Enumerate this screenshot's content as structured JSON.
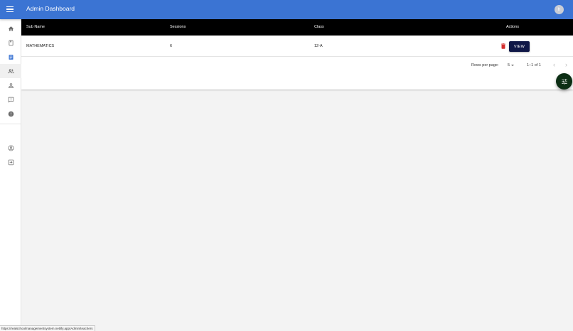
{
  "app": {
    "title": "Admin Dashboard",
    "avatar_initial": "h"
  },
  "sidebar": {
    "items": [
      {
        "name": "home-icon"
      },
      {
        "name": "classes-icon"
      },
      {
        "name": "subjects-icon",
        "active": true
      },
      {
        "name": "teachers-icon"
      },
      {
        "name": "students-icon"
      },
      {
        "name": "notices-icon"
      },
      {
        "name": "complains-icon"
      },
      {
        "name": "profile-icon"
      },
      {
        "name": "logout-icon"
      }
    ]
  },
  "table": {
    "columns": [
      "Sub Name",
      "Sessions",
      "Class",
      "Actions"
    ],
    "rows": [
      {
        "sub_name": "MATHEMATICS",
        "sessions": "6",
        "class": "12-A",
        "action_label": "VIEW"
      }
    ]
  },
  "pagination": {
    "rows_per_page_label": "Rows per page:",
    "rows_per_page": "5",
    "range": "1–1 of 1"
  },
  "status_url": "https://realschoolmanagementsystem.netlify.app/Admin/teachers",
  "colors": {
    "appbar": "#3b74d3",
    "view_button": "#0f1747",
    "delete_icon": "#d32f2f",
    "fab": "#0c2e14"
  }
}
